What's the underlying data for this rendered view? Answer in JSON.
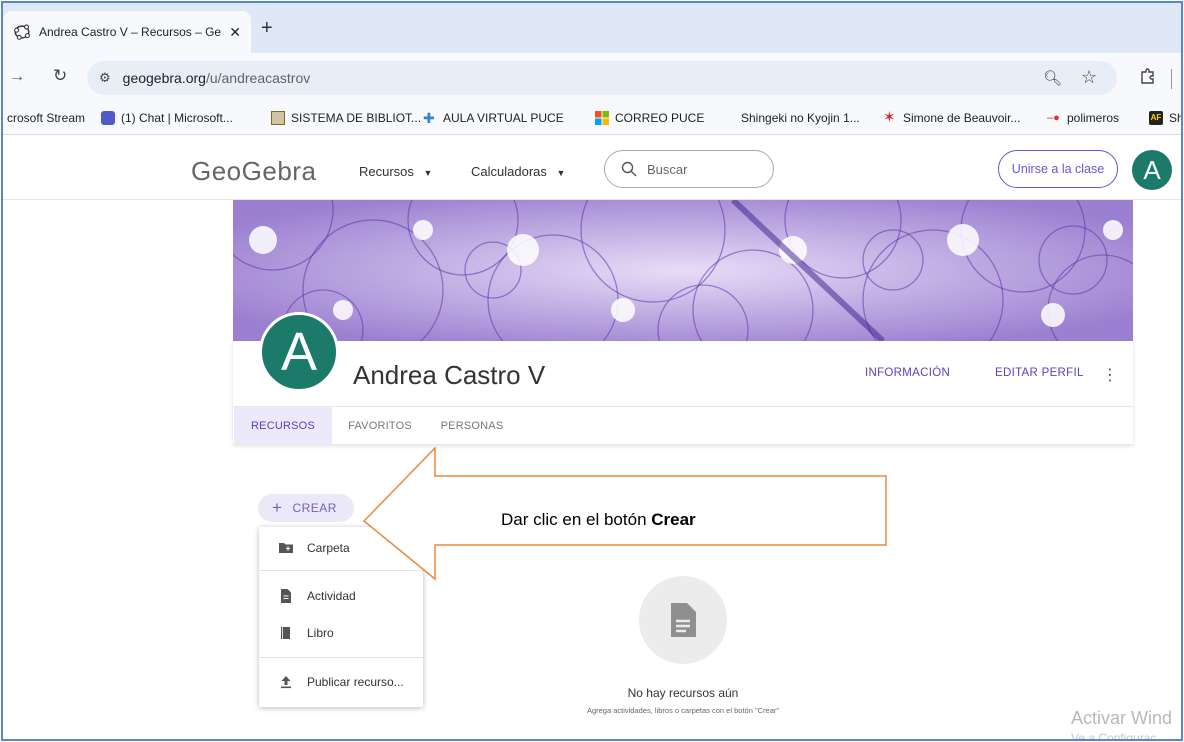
{
  "browser": {
    "tab_title": "Andrea Castro V – Recursos – Ge",
    "new_tab_label": "+",
    "url_host": "geogebra.org",
    "url_path": "/u/andreacastrov",
    "bookmarks": [
      {
        "label": "crosoft Stream",
        "icon": "stream-icon",
        "color": "#c2185b"
      },
      {
        "label": "(1) Chat | Microsoft...",
        "icon": "teams-icon",
        "color": "#5059c9"
      },
      {
        "label": "SISTEMA DE BIBLIOT...",
        "icon": "library-icon",
        "color": "#7a6a3a"
      },
      {
        "label": "AULA VIRTUAL PUCE",
        "icon": "aula-icon",
        "color": "#2f86c9"
      },
      {
        "label": "CORREO PUCE",
        "icon": "microsoft-icon",
        "color": "#f25022"
      },
      {
        "label": "Shingeki no Kyojin 1...",
        "icon": "blank-icon",
        "color": "#f7f9fd"
      },
      {
        "label": "Simone de Beauvoir...",
        "icon": "star-red-icon",
        "color": "#e0262b"
      },
      {
        "label": "polimeros",
        "icon": "molecule-icon",
        "color": "#d33"
      },
      {
        "label": "Sh",
        "icon": "af-icon",
        "color": "#222"
      }
    ]
  },
  "header": {
    "logo": "GeoGebra",
    "nav_resources": "Recursos",
    "nav_calculators": "Calculadoras",
    "search_placeholder": "Buscar",
    "join_button": "Unirse a la clase",
    "avatar_letter": "A",
    "accent": "#6557d2",
    "avatar_color": "#1b7a6a"
  },
  "profile": {
    "avatar_letter": "A",
    "name": "Andrea Castro V",
    "info_label": "INFORMACIÓN",
    "edit_label": "EDITAR PERFIL",
    "more_label": "⋮",
    "tabs": [
      "RECURSOS",
      "FAVORITOS",
      "PERSONAS"
    ],
    "active_tab": "RECURSOS"
  },
  "create": {
    "button_label": "CREAR",
    "menu": {
      "folder": "Carpeta",
      "activity": "Actividad",
      "book": "Libro",
      "publish": "Publicar recurso..."
    }
  },
  "empty_state": {
    "title": "No hay recursos aún",
    "subtitle": "Agrega actividades, libros o carpetas con el botón \"Crear\""
  },
  "annotation": {
    "text_prefix": "Dar clic en el botón ",
    "text_bold": "Crear",
    "arrow_color": "#e8893c"
  },
  "watermark": {
    "line1": "Activar Wind",
    "line2": "Ve a Configurac"
  }
}
